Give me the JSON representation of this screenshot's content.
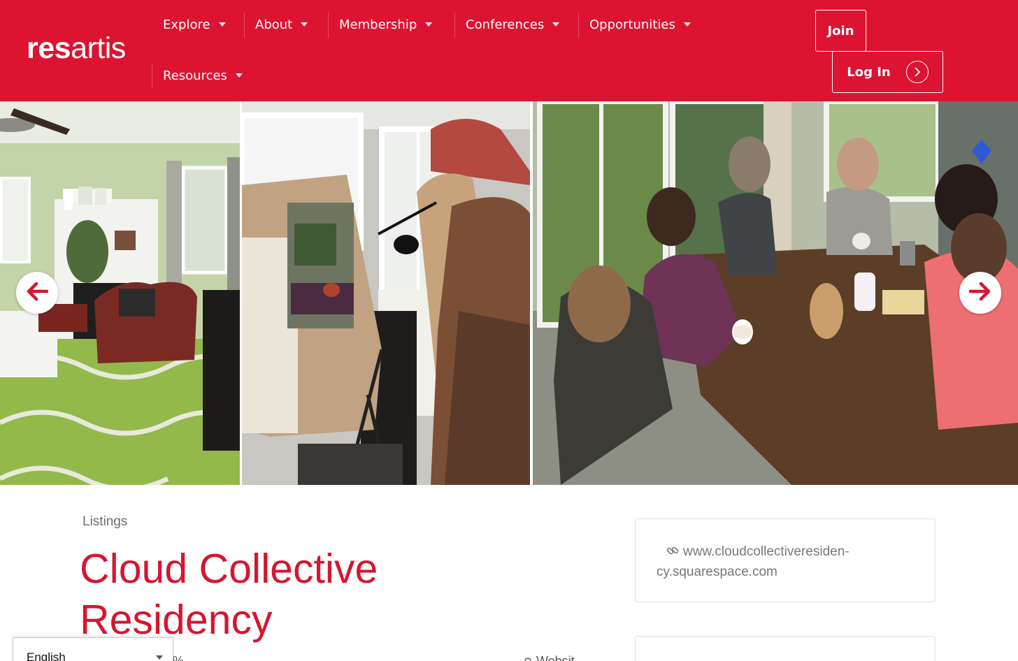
{
  "brand": {
    "logo_res": "res",
    "logo_artis": "artis",
    "accent_color": "#dc1431",
    "title_color": "#d5162f"
  },
  "nav": {
    "items": [
      {
        "label": "Explore"
      },
      {
        "label": "About"
      },
      {
        "label": "Membership"
      },
      {
        "label": "Conferences"
      },
      {
        "label": "Opportunities"
      },
      {
        "label": "Resources"
      }
    ],
    "join_label": "Join",
    "login_label": "Log In"
  },
  "gallery": {
    "prev_icon": "arrow-left-icon",
    "next_icon": "arrow-right-icon",
    "photos": [
      {
        "name": "bedroom-photo"
      },
      {
        "name": "artist-painting-photo"
      },
      {
        "name": "group-at-table-photo"
      }
    ]
  },
  "listing": {
    "breadcrumb": "Listings",
    "title_line1": "Cloud Collective",
    "title_line2": "Residency",
    "website_url_line1": "www.cloudcollectiveresiden-",
    "website_url_line2": "cy.squarespace.com"
  },
  "language": {
    "selected": "English"
  }
}
